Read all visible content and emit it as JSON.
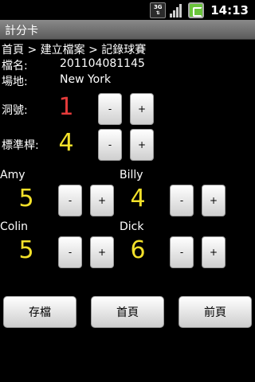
{
  "status_bar": {
    "network": "3G",
    "time": "14:13"
  },
  "app": {
    "title": "計分卡"
  },
  "breadcrumb": "首頁 > 建立檔案 > 記錄球賽",
  "file": {
    "label": "檔名:",
    "value": "201104081145"
  },
  "venue": {
    "label": "場地:",
    "value": "New York"
  },
  "hole": {
    "label": "洞號:",
    "value": "1",
    "minus": "-",
    "plus": "+"
  },
  "par": {
    "label": "標準桿:",
    "value": "4",
    "minus": "-",
    "plus": "+"
  },
  "players": [
    {
      "name": "Amy",
      "score": "5",
      "minus": "-",
      "plus": "+"
    },
    {
      "name": "Billy",
      "score": "4",
      "minus": "-",
      "plus": "+"
    },
    {
      "name": "Colin",
      "score": "5",
      "minus": "-",
      "plus": "+"
    },
    {
      "name": "Dick",
      "score": "6",
      "minus": "-",
      "plus": "+"
    }
  ],
  "actions": {
    "save": "存檔",
    "home": "首頁",
    "previous": "前頁"
  },
  "colors": {
    "hole_value": "#e53b3b",
    "score_value": "#f3e12a",
    "title_bar": "#6e6e6e"
  }
}
